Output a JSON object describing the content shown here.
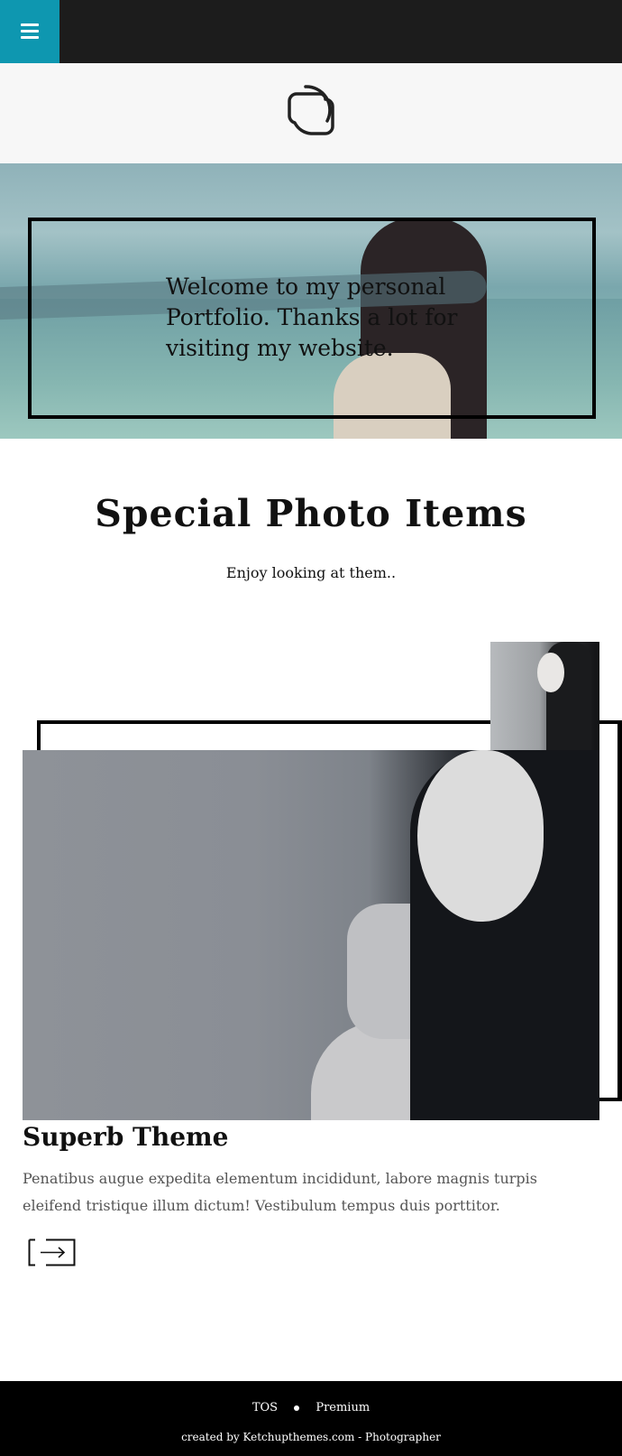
{
  "header": {
    "menu_icon": "hamburger-icon",
    "logo_icon": "camera-outline-logo"
  },
  "hero": {
    "text": "Welcome to my personal Portfolio. Thanks a lot for visiting my website."
  },
  "section": {
    "title": "Special Photo Items",
    "subtitle": "Enjoy looking at them.."
  },
  "item": {
    "title": "Superb Theme",
    "description": "Penatibus augue expedita elementum incididunt, labore magnis turpis eleifend tristique illum dictum! Vestibulum tempus duis porttitor.",
    "more_icon": "arrow-right-icon"
  },
  "footer": {
    "links": [
      "TOS",
      "Premium"
    ],
    "credit": "created by Ketchupthemes.com - Photographer"
  },
  "colors": {
    "accent": "#0e97b0",
    "topbar": "#1c1c1c",
    "footer": "#000000"
  }
}
